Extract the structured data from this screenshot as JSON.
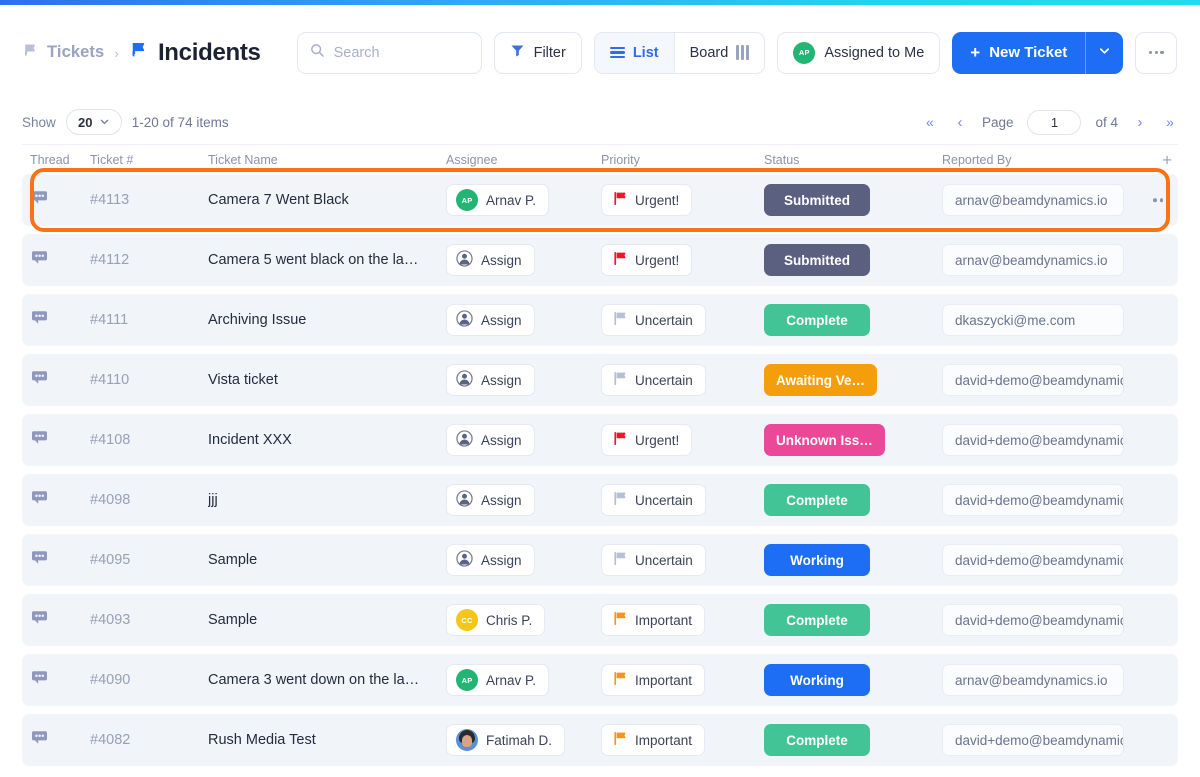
{
  "accent": {
    "from": "#2f6df0",
    "to": "#22d3ee"
  },
  "header": {
    "breadcrumb_parent": "Tickets",
    "breadcrumb_sep": "›",
    "breadcrumb_current": "Incidents",
    "search_placeholder": "Search",
    "search_value": "",
    "filter_label": "Filter",
    "view_list_label": "List",
    "view_board_label": "Board",
    "assigned_label": "Assigned to Me",
    "assigned_avatar_initials": "AP",
    "assigned_avatar_color": "#22b573",
    "new_ticket_label": "New Ticket",
    "new_ticket_plus": "+",
    "new_ticket_color": "#1d6ef5",
    "dropdown_caret": "⌄",
    "overflow_label": "more-options"
  },
  "pagination": {
    "show_label": "Show",
    "page_size": "20",
    "item_range": "1-20 of 74 items",
    "first_label": "«",
    "prev_label": "‹",
    "page_label": "Page",
    "page_value": "1",
    "of_label": "of 4",
    "next_label": "›",
    "last_label": "»"
  },
  "table": {
    "columns": [
      {
        "key": "thread",
        "label": "Thread"
      },
      {
        "key": "number",
        "label": "Ticket #"
      },
      {
        "key": "name",
        "label": "Ticket Name"
      },
      {
        "key": "assignee",
        "label": "Assignee"
      },
      {
        "key": "priority",
        "label": "Priority"
      },
      {
        "key": "status",
        "label": "Status"
      },
      {
        "key": "reporter",
        "label": "Reported By"
      }
    ],
    "add_column_label": "+",
    "assign_placeholder": "Assign",
    "status_colors": {
      "Submitted": "#5c6080",
      "Complete": "#42c496",
      "Awaiting Ve…": "#f59e0b",
      "Unknown Iss…": "#ec4899",
      "Working": "#1d6ef5"
    },
    "priority_colors": {
      "Urgent!": "#e8192c",
      "Important": "#f7941d",
      "Uncertain": "#b7bfd2"
    },
    "rows": [
      {
        "number": "#4113",
        "name": "Camera 7 Went Black",
        "assignee": "Arnav P.",
        "assignee_initials": "AP",
        "assignee_color": "#22b573",
        "assignee_type": "initials",
        "priority": "Urgent!",
        "status": "Submitted",
        "reporter": "arnav@beamdynamics.io",
        "focused": true
      },
      {
        "number": "#4112",
        "name": "Camera 5 went black on the la…",
        "assignee": "",
        "assignee_type": "none",
        "priority": "Urgent!",
        "status": "Submitted",
        "reporter": "arnav@beamdynamics.io",
        "focused": false
      },
      {
        "number": "#4111",
        "name": "Archiving Issue",
        "assignee": "",
        "assignee_type": "none",
        "priority": "Uncertain",
        "status": "Complete",
        "reporter": "dkaszycki@me.com",
        "focused": false
      },
      {
        "number": "#4110",
        "name": "Vista ticket",
        "assignee": "",
        "assignee_type": "none",
        "priority": "Uncertain",
        "status": "Awaiting Ve…",
        "reporter": "david+demo@beamdynamics.io",
        "focused": false
      },
      {
        "number": "#4108",
        "name": "Incident XXX",
        "assignee": "",
        "assignee_type": "none",
        "priority": "Urgent!",
        "status": "Unknown Iss…",
        "reporter": "david+demo@beamdynamics.io",
        "focused": false
      },
      {
        "number": "#4098",
        "name": "jjj",
        "assignee": "",
        "assignee_type": "none",
        "priority": "Uncertain",
        "status": "Complete",
        "reporter": "david+demo@beamdynamics.io",
        "focused": false
      },
      {
        "number": "#4095",
        "name": "Sample",
        "assignee": "",
        "assignee_type": "none",
        "priority": "Uncertain",
        "status": "Working",
        "reporter": "david+demo@beamdynamics.io",
        "focused": false
      },
      {
        "number": "#4093",
        "name": "Sample",
        "assignee": "Chris P.",
        "assignee_initials": "CC",
        "assignee_color": "#f5c518",
        "assignee_type": "initials",
        "priority": "Important",
        "status": "Complete",
        "reporter": "david+demo@beamdynamics.io",
        "focused": false
      },
      {
        "number": "#4090",
        "name": "Camera 3 went down on the la…",
        "assignee": "Arnav P.",
        "assignee_initials": "AP",
        "assignee_color": "#22b573",
        "assignee_type": "initials",
        "priority": "Important",
        "status": "Working",
        "reporter": "arnav@beamdynamics.io",
        "focused": false
      },
      {
        "number": "#4082",
        "name": "Rush Media Test",
        "assignee": "Fatimah D.",
        "assignee_initials": "",
        "assignee_color": "#5b8fd6",
        "assignee_type": "photo",
        "priority": "Important",
        "status": "Complete",
        "reporter": "david+demo@beamdynamics.io",
        "focused": false
      }
    ]
  }
}
